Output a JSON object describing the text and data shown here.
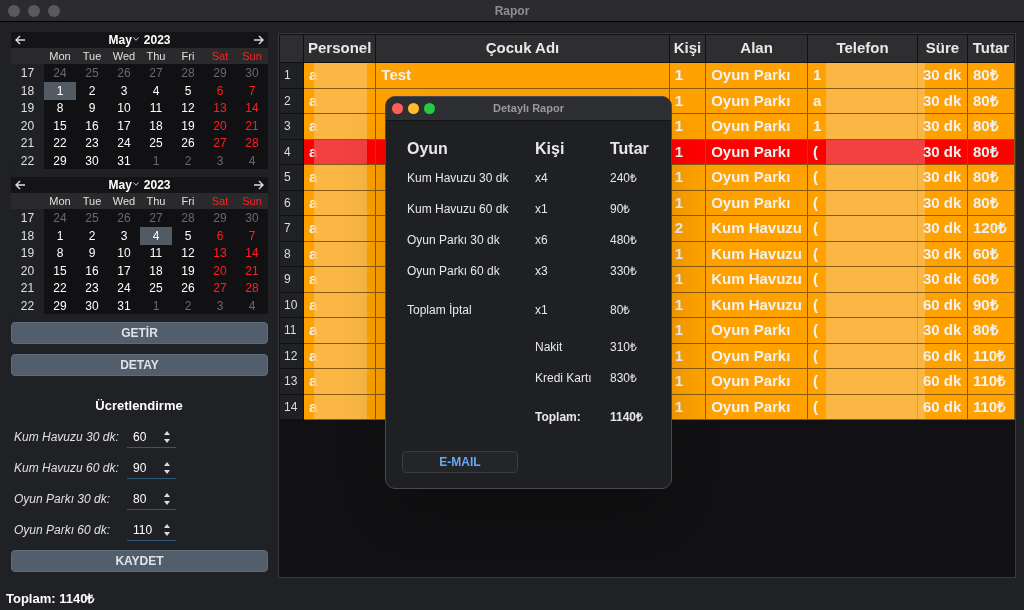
{
  "window": {
    "title": "Rapor"
  },
  "calendars": [
    {
      "month": "May",
      "year": "2023",
      "weekdays": [
        {
          "label": "Mon",
          "weekend": false
        },
        {
          "label": "Tue",
          "weekend": false
        },
        {
          "label": "Wed",
          "weekend": false
        },
        {
          "label": "Thu",
          "weekend": false
        },
        {
          "label": "Fri",
          "weekend": false
        },
        {
          "label": "Sat",
          "weekend": true
        },
        {
          "label": "Sun",
          "weekend": true
        }
      ],
      "weeks": [
        {
          "number": "17",
          "days": [
            {
              "day": "24",
              "other_month": true,
              "selected": false
            },
            {
              "day": "25",
              "other_month": true,
              "selected": false
            },
            {
              "day": "26",
              "other_month": true,
              "selected": false
            },
            {
              "day": "27",
              "other_month": true,
              "selected": false
            },
            {
              "day": "28",
              "other_month": true,
              "selected": false
            },
            {
              "day": "29",
              "other_month": true,
              "selected": false
            },
            {
              "day": "30",
              "other_month": true,
              "selected": false
            }
          ]
        },
        {
          "number": "18",
          "days": [
            {
              "day": "1",
              "other_month": false,
              "selected": true
            },
            {
              "day": "2",
              "other_month": false,
              "selected": false
            },
            {
              "day": "3",
              "other_month": false,
              "selected": false
            },
            {
              "day": "4",
              "other_month": false,
              "selected": false
            },
            {
              "day": "5",
              "other_month": false,
              "selected": false
            },
            {
              "day": "6",
              "other_month": false,
              "selected": false
            },
            {
              "day": "7",
              "other_month": false,
              "selected": false
            }
          ]
        },
        {
          "number": "19",
          "days": [
            {
              "day": "8",
              "other_month": false,
              "selected": false
            },
            {
              "day": "9",
              "other_month": false,
              "selected": false
            },
            {
              "day": "10",
              "other_month": false,
              "selected": false
            },
            {
              "day": "11",
              "other_month": false,
              "selected": false
            },
            {
              "day": "12",
              "other_month": false,
              "selected": false
            },
            {
              "day": "13",
              "other_month": false,
              "selected": false
            },
            {
              "day": "14",
              "other_month": false,
              "selected": false
            }
          ]
        },
        {
          "number": "20",
          "days": [
            {
              "day": "15",
              "other_month": false,
              "selected": false
            },
            {
              "day": "16",
              "other_month": false,
              "selected": false
            },
            {
              "day": "17",
              "other_month": false,
              "selected": false
            },
            {
              "day": "18",
              "other_month": false,
              "selected": false
            },
            {
              "day": "19",
              "other_month": false,
              "selected": false
            },
            {
              "day": "20",
              "other_month": false,
              "selected": false
            },
            {
              "day": "21",
              "other_month": false,
              "selected": false
            }
          ]
        },
        {
          "number": "21",
          "days": [
            {
              "day": "22",
              "other_month": false,
              "selected": false
            },
            {
              "day": "23",
              "other_month": false,
              "selected": false
            },
            {
              "day": "24",
              "other_month": false,
              "selected": false
            },
            {
              "day": "25",
              "other_month": false,
              "selected": false
            },
            {
              "day": "26",
              "other_month": false,
              "selected": false
            },
            {
              "day": "27",
              "other_month": false,
              "selected": false
            },
            {
              "day": "28",
              "other_month": false,
              "selected": false
            }
          ]
        },
        {
          "number": "22",
          "days": [
            {
              "day": "29",
              "other_month": false,
              "selected": false
            },
            {
              "day": "30",
              "other_month": false,
              "selected": false
            },
            {
              "day": "31",
              "other_month": false,
              "selected": false
            },
            {
              "day": "1",
              "other_month": true,
              "selected": false
            },
            {
              "day": "2",
              "other_month": true,
              "selected": false
            },
            {
              "day": "3",
              "other_month": true,
              "selected": false
            },
            {
              "day": "4",
              "other_month": true,
              "selected": false
            }
          ]
        }
      ]
    },
    {
      "month": "May",
      "year": "2023",
      "weekdays": [
        {
          "label": "Mon",
          "weekend": false
        },
        {
          "label": "Tue",
          "weekend": false
        },
        {
          "label": "Wed",
          "weekend": false
        },
        {
          "label": "Thu",
          "weekend": false
        },
        {
          "label": "Fri",
          "weekend": false
        },
        {
          "label": "Sat",
          "weekend": true
        },
        {
          "label": "Sun",
          "weekend": true
        }
      ],
      "weeks": [
        {
          "number": "17",
          "days": [
            {
              "day": "24",
              "other_month": true,
              "selected": false
            },
            {
              "day": "25",
              "other_month": true,
              "selected": false
            },
            {
              "day": "26",
              "other_month": true,
              "selected": false
            },
            {
              "day": "27",
              "other_month": true,
              "selected": false
            },
            {
              "day": "28",
              "other_month": true,
              "selected": false
            },
            {
              "day": "29",
              "other_month": true,
              "selected": false
            },
            {
              "day": "30",
              "other_month": true,
              "selected": false
            }
          ]
        },
        {
          "number": "18",
          "days": [
            {
              "day": "1",
              "other_month": false,
              "selected": false
            },
            {
              "day": "2",
              "other_month": false,
              "selected": false
            },
            {
              "day": "3",
              "other_month": false,
              "selected": false
            },
            {
              "day": "4",
              "other_month": false,
              "selected": true
            },
            {
              "day": "5",
              "other_month": false,
              "selected": false
            },
            {
              "day": "6",
              "other_month": false,
              "selected": false
            },
            {
              "day": "7",
              "other_month": false,
              "selected": false
            }
          ]
        },
        {
          "number": "19",
          "days": [
            {
              "day": "8",
              "other_month": false,
              "selected": false
            },
            {
              "day": "9",
              "other_month": false,
              "selected": false
            },
            {
              "day": "10",
              "other_month": false,
              "selected": false
            },
            {
              "day": "11",
              "other_month": false,
              "selected": false
            },
            {
              "day": "12",
              "other_month": false,
              "selected": false
            },
            {
              "day": "13",
              "other_month": false,
              "selected": false
            },
            {
              "day": "14",
              "other_month": false,
              "selected": false
            }
          ]
        },
        {
          "number": "20",
          "days": [
            {
              "day": "15",
              "other_month": false,
              "selected": false
            },
            {
              "day": "16",
              "other_month": false,
              "selected": false
            },
            {
              "day": "17",
              "other_month": false,
              "selected": false
            },
            {
              "day": "18",
              "other_month": false,
              "selected": false
            },
            {
              "day": "19",
              "other_month": false,
              "selected": false
            },
            {
              "day": "20",
              "other_month": false,
              "selected": false
            },
            {
              "day": "21",
              "other_month": false,
              "selected": false
            }
          ]
        },
        {
          "number": "21",
          "days": [
            {
              "day": "22",
              "other_month": false,
              "selected": false
            },
            {
              "day": "23",
              "other_month": false,
              "selected": false
            },
            {
              "day": "24",
              "other_month": false,
              "selected": false
            },
            {
              "day": "25",
              "other_month": false,
              "selected": false
            },
            {
              "day": "26",
              "other_month": false,
              "selected": false
            },
            {
              "day": "27",
              "other_month": false,
              "selected": false
            },
            {
              "day": "28",
              "other_month": false,
              "selected": false
            }
          ]
        },
        {
          "number": "22",
          "days": [
            {
              "day": "29",
              "other_month": false,
              "selected": false
            },
            {
              "day": "30",
              "other_month": false,
              "selected": false
            },
            {
              "day": "31",
              "other_month": false,
              "selected": false
            },
            {
              "day": "1",
              "other_month": true,
              "selected": false
            },
            {
              "day": "2",
              "other_month": true,
              "selected": false
            },
            {
              "day": "3",
              "other_month": true,
              "selected": false
            },
            {
              "day": "4",
              "other_month": true,
              "selected": false
            }
          ]
        }
      ]
    }
  ],
  "buttons": [
    "GETİR",
    "DETAY"
  ],
  "pricing": {
    "title": "Ücretlendirme",
    "fields": [
      {
        "label": "Kum Havuzu 30 dk:",
        "value": "60"
      },
      {
        "label": "Kum Havuzu 60 dk:",
        "value": "90"
      },
      {
        "label": "Oyun Parkı 30 dk:",
        "value": "80"
      },
      {
        "label": "Oyun Parkı 60 dk:",
        "value": "110"
      }
    ],
    "save_button": "KAYDET"
  },
  "table": {
    "columns": [
      "",
      "Personel",
      "Çocuk Adı",
      "Kişi",
      "Alan",
      "Telefon",
      "Süre",
      "Tutar"
    ],
    "rows": [
      {
        "number": "1",
        "personel": "a",
        "cocuk_adi": "Test",
        "kisi": "1",
        "alan": "Oyun Parkı",
        "telefon": "1",
        "sure": "30 dk",
        "tutar": "80₺",
        "selected": false
      },
      {
        "number": "2",
        "personel": "a",
        "kisi": "1",
        "alan": "Oyun Parkı",
        "telefon": "a",
        "sure": "30 dk",
        "tutar": "80₺",
        "selected": false
      },
      {
        "number": "3",
        "personel": "a",
        "kisi": "1",
        "alan": "Oyun Parkı",
        "telefon": "1",
        "sure": "30 dk",
        "tutar": "80₺",
        "selected": false
      },
      {
        "number": "4",
        "personel": "a",
        "kisi": "1",
        "alan": "Oyun Parkı",
        "telefon": "(",
        "sure": "30 dk",
        "tutar": "80₺",
        "selected": true
      },
      {
        "number": "5",
        "personel": "a",
        "kisi": "1",
        "alan": "Oyun Parkı",
        "telefon": "(",
        "sure": "30 dk",
        "tutar": "80₺",
        "selected": false
      },
      {
        "number": "6",
        "personel": "a",
        "kisi": "1",
        "alan": "Oyun Parkı",
        "telefon": "(",
        "sure": "30 dk",
        "tutar": "80₺",
        "selected": false
      },
      {
        "number": "7",
        "personel": "a",
        "kisi": "2",
        "alan": "Kum Havuzu",
        "telefon": "(",
        "sure": "30 dk",
        "tutar": "120₺",
        "selected": false
      },
      {
        "number": "8",
        "personel": "a",
        "kisi": "1",
        "alan": "Kum Havuzu",
        "telefon": "(",
        "sure": "30 dk",
        "tutar": "60₺",
        "selected": false
      },
      {
        "number": "9",
        "personel": "a",
        "kisi": "1",
        "alan": "Kum Havuzu",
        "telefon": "(",
        "sure": "30 dk",
        "tutar": "60₺",
        "selected": false
      },
      {
        "number": "10",
        "personel": "a",
        "kisi": "1",
        "alan": "Kum Havuzu",
        "telefon": "(",
        "sure": "60 dk",
        "tutar": "90₺",
        "selected": false
      },
      {
        "number": "11",
        "personel": "a",
        "kisi": "1",
        "alan": "Oyun Parkı",
        "telefon": "(",
        "sure": "30 dk",
        "tutar": "80₺",
        "selected": false
      },
      {
        "number": "12",
        "personel": "a",
        "kisi": "1",
        "alan": "Oyun Parkı",
        "telefon": "(",
        "sure": "60 dk",
        "tutar": "110₺",
        "selected": false
      },
      {
        "number": "13",
        "personel": "a",
        "kisi": "1",
        "alan": "Oyun Parkı",
        "telefon": "(",
        "sure": "60 dk",
        "tutar": "110₺",
        "selected": false
      },
      {
        "number": "14",
        "personel": "a",
        "kisi": "1",
        "alan": "Oyun Parkı",
        "telefon": "(",
        "sure": "60 dk",
        "tutar": "110₺",
        "selected": false
      }
    ]
  },
  "dialog": {
    "title": "Detaylı Rapor",
    "columns": [
      "Oyun",
      "Kişi",
      "Tutar"
    ],
    "items": [
      {
        "oyun": "Kum Havuzu 30 dk",
        "kisi": "x4",
        "tutar": "240₺"
      },
      {
        "oyun": "Kum Havuzu 60 dk",
        "kisi": "x1",
        "tutar": "90₺"
      },
      {
        "oyun": "Oyun Parkı 30 dk",
        "kisi": "x6",
        "tutar": "480₺"
      },
      {
        "oyun": "Oyun Parkı 60 dk",
        "kisi": "x3",
        "tutar": "330₺"
      }
    ],
    "cancel": {
      "label": "Toplam İptal",
      "kisi": "x1",
      "tutar": "80₺"
    },
    "payments": [
      {
        "label": "Nakit",
        "tutar": "310₺"
      },
      {
        "label": "Kredi Kartı",
        "tutar": "830₺"
      }
    ],
    "total": {
      "label": "Toplam:",
      "tutar": "1140₺"
    },
    "email_button": "E-MAIL"
  },
  "status_bar": "Toplam: 1140₺"
}
